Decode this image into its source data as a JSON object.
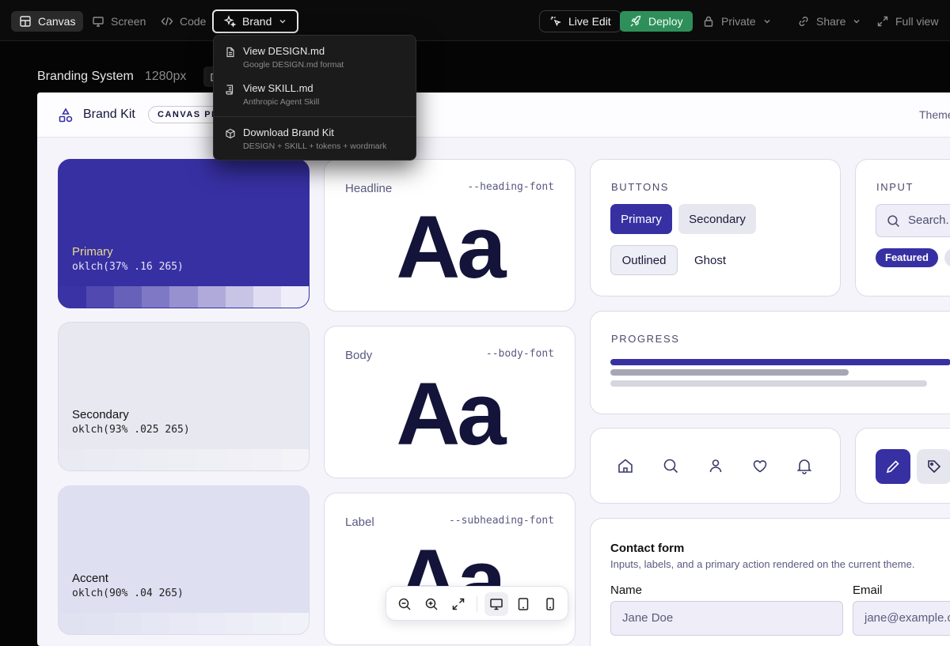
{
  "toolbar": {
    "canvas_label": "Canvas",
    "screen_label": "Screen",
    "code_label": "Code",
    "brand_label": "Brand",
    "live_edit_label": "Live Edit",
    "deploy_label": "Deploy",
    "private_label": "Private",
    "share_label": "Share",
    "full_view_label": "Full view",
    "colors": {
      "deploy": "#2f8f5b"
    }
  },
  "brand_menu": {
    "items": [
      {
        "title": "View DESIGN.md",
        "subtitle": "Google DESIGN.md format",
        "icon": "document-icon"
      },
      {
        "title": "View SKILL.md",
        "subtitle": "Anthropic Agent Skill",
        "icon": "scroll-icon"
      },
      {
        "title": "Download Brand Kit",
        "subtitle": "DESIGN + SKILL + tokens + wordmark",
        "icon": "package-icon"
      }
    ]
  },
  "page": {
    "title": "Branding System",
    "width_label": "1280px"
  },
  "kit": {
    "name": "Brand Kit",
    "badge": "CANVAS PR",
    "theme_label": "Theme"
  },
  "swatches": [
    {
      "name": "Primary",
      "value": "oklch(37% .16 265)",
      "color": "#3730a3"
    },
    {
      "name": "Secondary",
      "value": "oklch(93% .025 265)",
      "color": "#e8e8f1"
    },
    {
      "name": "Accent",
      "value": "oklch(90% .04 265)",
      "color": "#dedff0"
    }
  ],
  "typography": [
    {
      "label": "Headline",
      "variable": "--heading-font",
      "sample": "Aa"
    },
    {
      "label": "Body",
      "variable": "--body-font",
      "sample": "Aa"
    },
    {
      "label": "Label",
      "variable": "--subheading-font",
      "sample": "Aa"
    }
  ],
  "buttons": {
    "heading": "BUTTONS",
    "primary": "Primary",
    "secondary": "Secondary",
    "outlined": "Outlined",
    "ghost": "Ghost"
  },
  "input": {
    "heading": "INPUT",
    "placeholder": "Search...",
    "tag_featured": "Featured"
  },
  "progress": {
    "heading": "PROGRESS",
    "bars": [
      {
        "fraction": 1.0,
        "color": "#3730a3"
      },
      {
        "fraction": 0.7,
        "color": "#a6a6b4"
      },
      {
        "fraction": 0.93,
        "color": "#d6d6df"
      }
    ]
  },
  "icon_row": [
    "home-icon",
    "search-icon",
    "user-icon",
    "heart-icon",
    "bell-icon"
  ],
  "contact_form": {
    "title": "Contact form",
    "description": "Inputs, labels, and a primary action rendered on the current theme.",
    "name_label": "Name",
    "name_value": "Jane Doe",
    "email_label": "Email",
    "email_value": "jane@example.c"
  }
}
